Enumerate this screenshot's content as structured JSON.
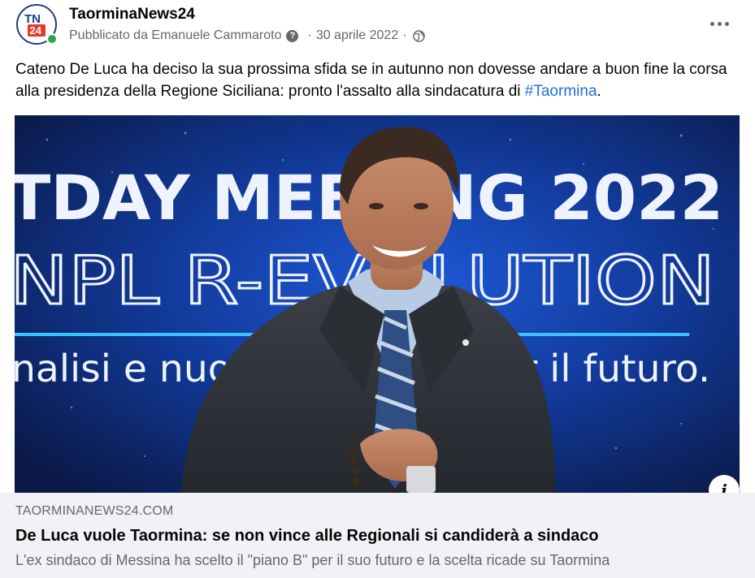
{
  "post": {
    "page_name": "TaorminaNews24",
    "avatar_text": "TN24",
    "published_by": "Pubblicato da Emanuele Cammaroto",
    "question_mark": "?",
    "separator": "·",
    "date": "30 aprile 2022",
    "privacy_icon": "globe-icon",
    "more_icon": "more-horizontal-icon",
    "text": "Cateno De Luca ha deciso la sua prossima sfida se in autunno non dovesse andare a buon fine la corsa alla presidenza della Regione Siciliana: pronto l'assalto alla sindacatura di ",
    "hashtag": "#Taormina",
    "text_end": "."
  },
  "media": {
    "screen_line1": "TDAY MEETING 2022",
    "screen_line2": "NPL R-EVOLUTION",
    "screen_line3": "nalisi e nuove strategie per il futuro.",
    "colors": {
      "background": "#0b1a4a",
      "glow": "#1e5ad8",
      "text": "#eef3ff",
      "accent": "#39c4ff"
    }
  },
  "link_preview": {
    "domain": "TAORMINANEWS24.COM",
    "title": "De Luca vuole Taormina: se non vince alle Regionali si candiderà a sindaco",
    "description": "L'ex sindaco di Messina ha scelto il \"piano B\" per il suo futuro e la scelta ricade su Taormina",
    "info_label": "i",
    "info_icon": "info-icon"
  }
}
